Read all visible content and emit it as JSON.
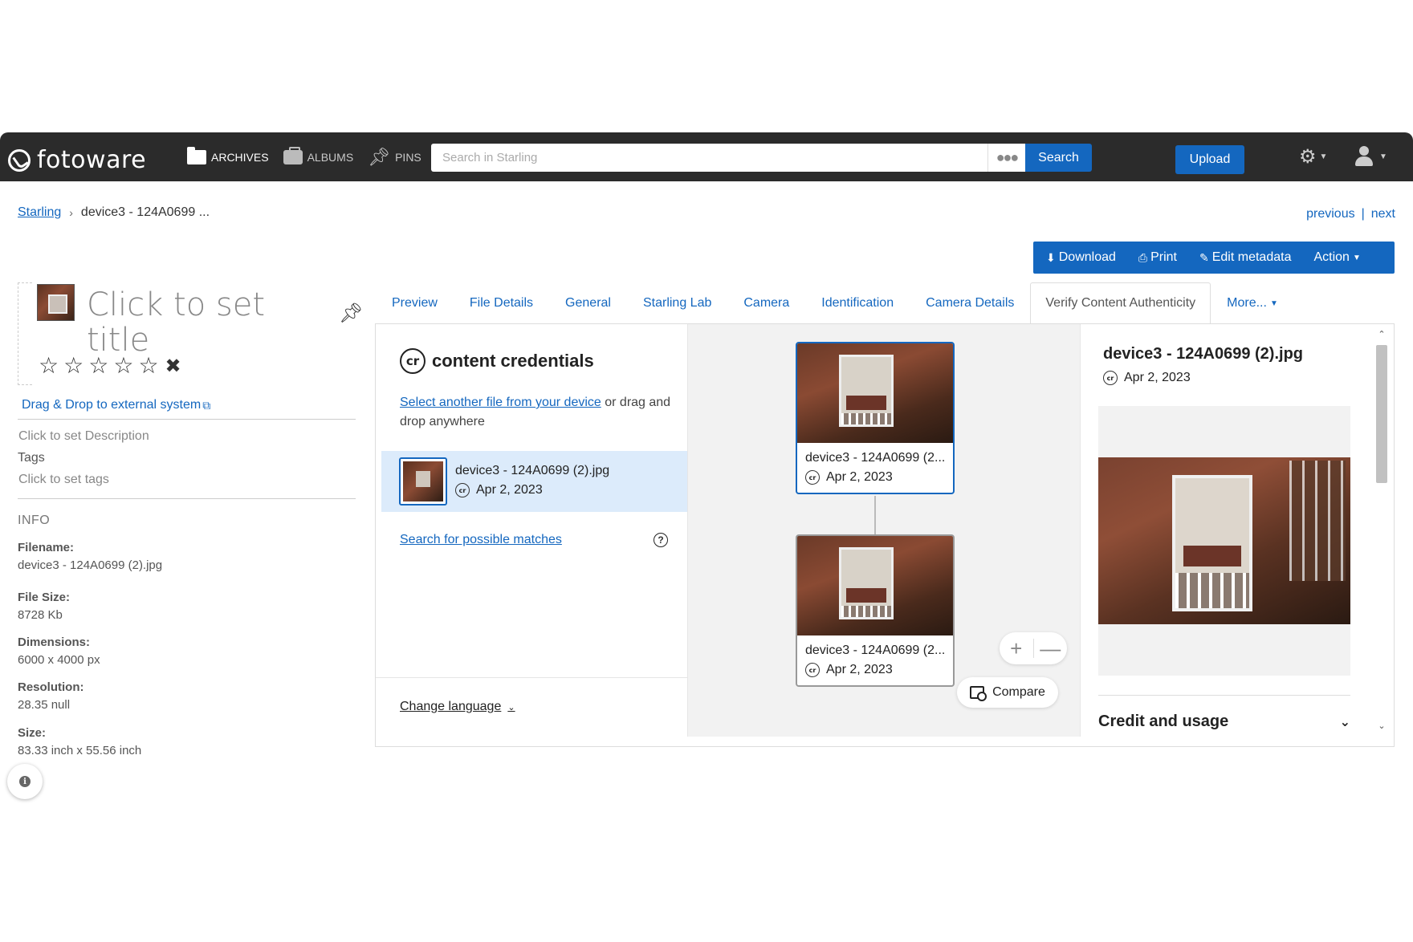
{
  "topbar": {
    "brand": "fotoware",
    "nav": [
      {
        "label": "ARCHIVES",
        "icon": "folder-icon"
      },
      {
        "label": "ALBUMS",
        "icon": "briefcase-icon"
      },
      {
        "label": "PINS",
        "icon": "pin-icon"
      }
    ],
    "search_placeholder": "Search in Starling",
    "search_label": "Search",
    "upload_label": "Upload"
  },
  "breadcrumb": {
    "root": "Starling",
    "current": "device3 - 124A0699 ..."
  },
  "pager": {
    "previous": "previous",
    "separator": "|",
    "next": "next"
  },
  "actions": {
    "download": "Download",
    "print": "Print",
    "edit_metadata": "Edit metadata",
    "action": "Action"
  },
  "left": {
    "title_placeholder": "Click to set title",
    "rating": 0,
    "drag_drop": "Drag & Drop to external system",
    "description_placeholder": "Click to set Description",
    "tags_label": "Tags",
    "tags_placeholder": "Click to set tags",
    "info_heading": "INFO",
    "info": [
      {
        "key": "Filename:",
        "value": "device3 - 124A0699 (2).jpg"
      },
      {
        "key": "File Size:",
        "value": "8728 Kb"
      },
      {
        "key": "Dimensions:",
        "value": "6000 x 4000 px"
      },
      {
        "key": "Resolution:",
        "value": "28.35 null"
      },
      {
        "key": "Size:",
        "value": "83.33 inch x 55.56 inch"
      }
    ]
  },
  "tabs": [
    {
      "label": "Preview",
      "active": false
    },
    {
      "label": "File Details",
      "active": false
    },
    {
      "label": "General",
      "active": false
    },
    {
      "label": "Starling Lab",
      "active": false
    },
    {
      "label": "Camera",
      "active": false
    },
    {
      "label": "Identification",
      "active": false
    },
    {
      "label": "Camera Details",
      "active": false
    },
    {
      "label": "Verify Content Authenticity",
      "active": true
    },
    {
      "label": "More...",
      "active": false
    }
  ],
  "cc": {
    "badge": "cr",
    "brand": "content credentials",
    "select_link": "Select another file from your device",
    "select_rest": " or drag and drop anywhere",
    "file_name": "device3 - 124A0699 (2).jpg",
    "file_date": "Apr 2, 2023",
    "search_link": "Search for possible matches",
    "help": "?",
    "language": "Change language"
  },
  "graph": {
    "nodes": [
      {
        "name": "device3 - 124A0699 (2...",
        "date": "Apr 2, 2023",
        "selected": true
      },
      {
        "name": "device3 - 124A0699 (2...",
        "date": "Apr 2, 2023",
        "selected": false
      }
    ],
    "zoom_in": "+",
    "zoom_out": "—",
    "compare": "Compare"
  },
  "detail": {
    "title": "device3 - 124A0699 (2).jpg",
    "date": "Apr 2, 2023",
    "credit_section": "Credit and usage"
  },
  "colors": {
    "topbar": "#2b2b2b",
    "accent": "#1467bf",
    "selected_row": "#dcebfb"
  }
}
